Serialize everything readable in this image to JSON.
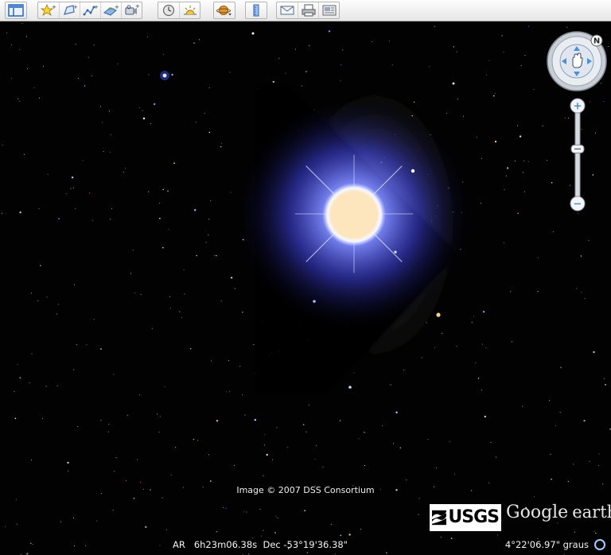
{
  "toolbar": {
    "groups": [
      {
        "buttons": [
          {
            "icon": "sidebar-icon",
            "label": "Sidebar"
          }
        ]
      },
      {
        "buttons": [
          {
            "icon": "placemark-icon",
            "label": "Add Placemark"
          },
          {
            "icon": "polygon-icon",
            "label": "Add Polygon"
          },
          {
            "icon": "path-icon",
            "label": "Add Path"
          },
          {
            "icon": "image-overlay-icon",
            "label": "Add Image Overlay"
          },
          {
            "icon": "record-tour-icon",
            "label": "Record a Tour"
          }
        ]
      },
      {
        "buttons": [
          {
            "icon": "historical-imagery-icon",
            "label": "Historical Imagery"
          },
          {
            "icon": "sunlight-icon",
            "label": "Sunlight"
          }
        ]
      },
      {
        "buttons": [
          {
            "icon": "planet-icon",
            "label": "Switch between Earth, Sky and other planets"
          }
        ]
      },
      {
        "buttons": [
          {
            "icon": "ruler-icon",
            "label": "Ruler"
          }
        ]
      },
      {
        "buttons": [
          {
            "icon": "email-icon",
            "label": "Email"
          },
          {
            "icon": "print-icon",
            "label": "Print"
          },
          {
            "icon": "save-image-icon",
            "label": "Save Image"
          }
        ]
      }
    ]
  },
  "navigation": {
    "compass_north_label": "N",
    "zoom_in_label": "+",
    "zoom_out_label": "−",
    "zoom_level": 0.47
  },
  "overlay": {
    "image_credit": "Image © 2007 DSS Consortium",
    "usgs_logo": "USGS",
    "google_earth_logo": {
      "google": "Google",
      "earth": "earth"
    }
  },
  "status": {
    "coordinates": "AR   6h23m06.38s  Dec -53°19'36.38\"",
    "eye_altitude": "4°22'06.97\" graus"
  },
  "colors": {
    "sky_background": "#000000",
    "star_glow": "#5a6cff",
    "star_core": "#fde7c0",
    "nav_accent": "#4a90d9"
  }
}
